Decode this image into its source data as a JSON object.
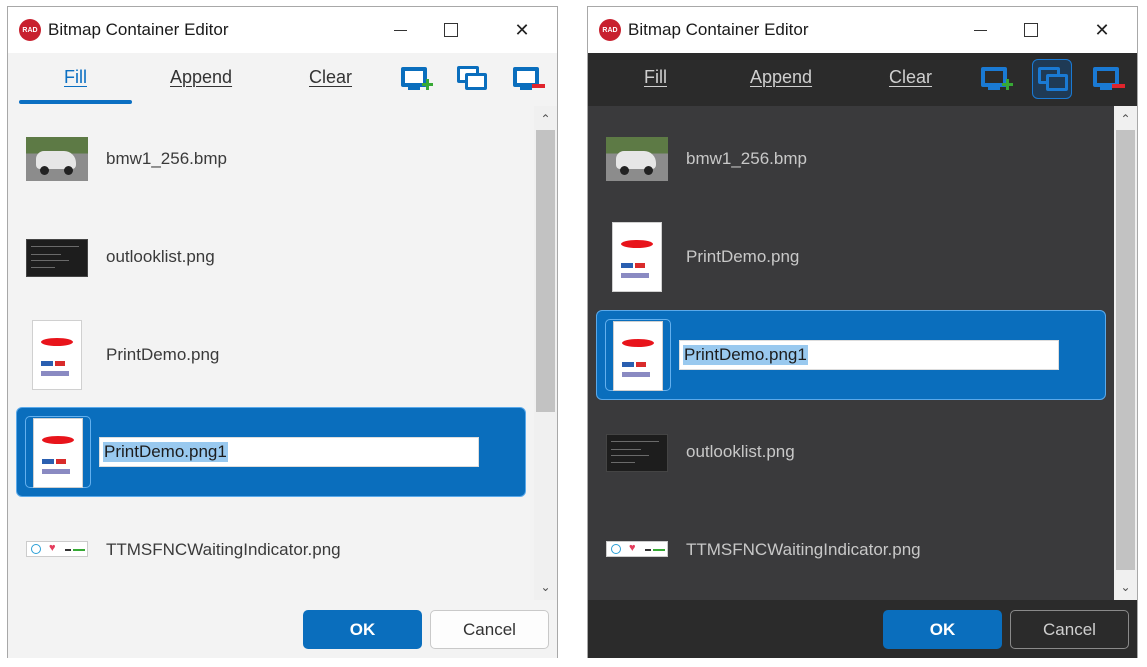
{
  "window": {
    "title": "Bitmap Container Editor",
    "logo_text": "RAD",
    "close_glyph": "✕"
  },
  "tabs": [
    {
      "label": "Fill"
    },
    {
      "label": "Append"
    },
    {
      "label": "Clear"
    }
  ],
  "toolbar_icons": [
    "add-image-icon",
    "multi-image-icon",
    "remove-image-icon"
  ],
  "accent_color": "#0a6ebd",
  "left_list": [
    {
      "name": "bmw1_256.bmp",
      "thumb": "car"
    },
    {
      "name": "outlooklist.png",
      "thumb": "dark"
    },
    {
      "name": "PrintDemo.png",
      "thumb": "print"
    },
    {
      "name": "PrintDemo.png1",
      "thumb": "print",
      "editing": true
    },
    {
      "name": "TTMSFNCWaitingIndicator.png",
      "thumb": "wait"
    }
  ],
  "right_list": [
    {
      "name": "bmw1_256.bmp",
      "thumb": "car"
    },
    {
      "name": "PrintDemo.png",
      "thumb": "print"
    },
    {
      "name": "PrintDemo.png1",
      "thumb": "print",
      "editing": true
    },
    {
      "name": "outlooklist.png",
      "thumb": "dark"
    },
    {
      "name": "TTMSFNCWaitingIndicator.png",
      "thumb": "wait"
    }
  ],
  "buttons": {
    "ok": "OK",
    "cancel": "Cancel"
  },
  "scroll": {
    "up": "⌃",
    "down": "⌄"
  }
}
